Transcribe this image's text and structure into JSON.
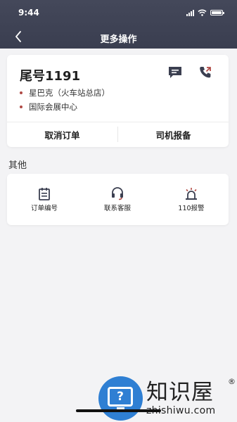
{
  "status_bar": {
    "time": "9:44"
  },
  "nav": {
    "title": "更多操作"
  },
  "order": {
    "tail_number": "尾号1191",
    "pickup": "星巴克（火车站总店）",
    "destination": "国际会展中心",
    "cancel_label": "取消订单",
    "report_label": "司机报备"
  },
  "other": {
    "section_title": "其他",
    "items": [
      {
        "label": "订单编号",
        "icon": "order-number-icon"
      },
      {
        "label": "联系客服",
        "icon": "headset-icon"
      },
      {
        "label": "110报警",
        "icon": "alarm-siren-icon"
      }
    ]
  },
  "watermark": {
    "cn": "知识屋",
    "en": "zhishiwu.com",
    "reg": "®",
    "glyph": "?"
  },
  "colors": {
    "header": "#3f4356",
    "accent": "#b04a45",
    "background": "#f3f3f5"
  }
}
